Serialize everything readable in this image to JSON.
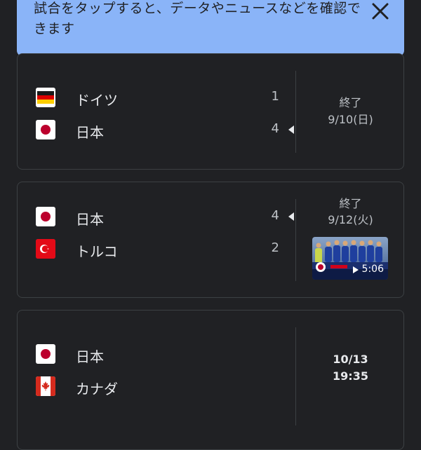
{
  "banner": {
    "text": "試合をタップすると、データやニュースなどを確認できます",
    "close_icon": "close-icon"
  },
  "matches": [
    {
      "teams": [
        {
          "name": "ドイツ",
          "score": "1",
          "flag": "germany-flag-icon",
          "winner": false
        },
        {
          "name": "日本",
          "score": "4",
          "flag": "japan-flag-icon",
          "winner": true
        }
      ],
      "status": "終了",
      "date": "9/10(日)"
    },
    {
      "teams": [
        {
          "name": "日本",
          "score": "4",
          "flag": "japan-flag-icon",
          "winner": true
        },
        {
          "name": "トルコ",
          "score": "2",
          "flag": "turkey-flag-icon",
          "winner": false
        }
      ],
      "status": "終了",
      "date": "9/12(火)",
      "video": {
        "duration": "5:06",
        "play_icon": "play-icon"
      }
    },
    {
      "teams": [
        {
          "name": "日本",
          "score": "",
          "flag": "japan-flag-icon",
          "winner": false
        },
        {
          "name": "カナダ",
          "score": "",
          "flag": "canada-flag-icon",
          "winner": false
        }
      ],
      "date": "10/13",
      "time": "19:35"
    }
  ],
  "colors": {
    "background": "#202124",
    "banner": "#8ab4f8",
    "card_border": "#3c4043",
    "text": "#e8eaed"
  }
}
